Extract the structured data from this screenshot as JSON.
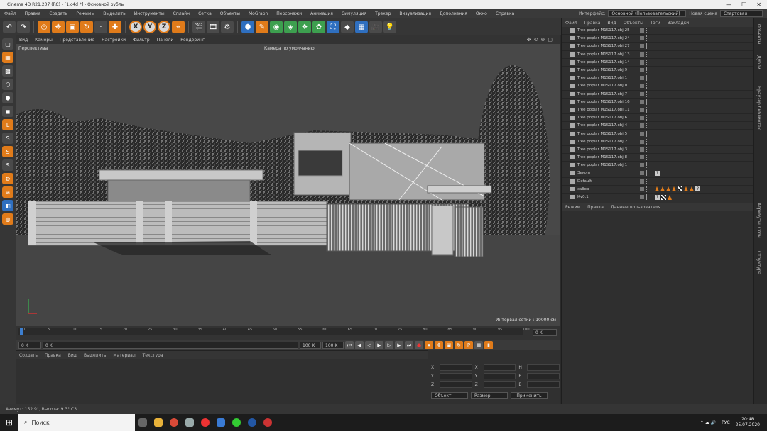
{
  "window": {
    "title": "Cinema 4D R21.207 (RC) - [1.c4d *] - Основной рубль"
  },
  "menu": [
    "Файл",
    "Правка",
    "Создать",
    "Режимы",
    "Выделить",
    "Инструменты",
    "Сплайн",
    "Сетка",
    "Объекты",
    "MoGraph",
    "Персонажи",
    "Анимация",
    "Симуляция",
    "Трекер",
    "Визуализация",
    "Дополнения",
    "Окно",
    "Справка"
  ],
  "menu_right": {
    "layout_label": "Интерфейс:",
    "layout_value": "Основной (Пользовательский)",
    "mode_label": "Новая сцена",
    "mode_value": "Стартовая"
  },
  "toolbar": {
    "axes": [
      "X",
      "Y",
      "Z"
    ]
  },
  "viewport": {
    "menu": [
      "Вид",
      "Камеры",
      "Представление",
      "Настройки",
      "Фильтр",
      "Панели",
      "Рендеринг"
    ],
    "view_label": "Перспектива",
    "camera_label": "Камера по умолчанию",
    "grid_label": "Интервал сетки : 10000 см"
  },
  "timeline": {
    "ticks": [
      "0",
      "5",
      "10",
      "15",
      "20",
      "25",
      "30",
      "35",
      "40",
      "45",
      "50",
      "55",
      "60",
      "65",
      "70",
      "75",
      "80",
      "85",
      "90",
      "95",
      "100"
    ],
    "end_frame": "0 K"
  },
  "transport": {
    "start": "0 K",
    "current": "0 K",
    "end_a": "100 K",
    "end_b": "100 K"
  },
  "material": {
    "menu": [
      "Создать",
      "Правка",
      "Вид",
      "Выделить",
      "Материал",
      "Текстура"
    ]
  },
  "coords": {
    "rows": [
      [
        "X",
        "X",
        "H"
      ],
      [
        "Y",
        "Y",
        "P"
      ],
      [
        "Z",
        "Z",
        "B"
      ]
    ],
    "col_a": "Объект",
    "col_b": "Размер",
    "apply": "Применить"
  },
  "objects": {
    "menu": [
      "Файл",
      "Правка",
      "Вид",
      "Объекты",
      "Тэги",
      "Закладки"
    ],
    "rows": [
      {
        "name": "Tree poplar M1S117.obj.25",
        "tags": []
      },
      {
        "name": "Tree poplar M1S117.obj.24",
        "tags": []
      },
      {
        "name": "Tree poplar M1S117.obj.27",
        "tags": []
      },
      {
        "name": "Tree poplar M1S117.obj.13",
        "tags": []
      },
      {
        "name": "Tree poplar M1S117.obj.14",
        "tags": []
      },
      {
        "name": "Tree poplar M1S117.obj.9",
        "tags": []
      },
      {
        "name": "Tree poplar M1S117.obj.1",
        "tags": []
      },
      {
        "name": "Tree poplar M1S117.obj.0",
        "tags": []
      },
      {
        "name": "Tree poplar M1S117.obj.7",
        "tags": []
      },
      {
        "name": "Tree poplar M1S117.obj.16",
        "tags": []
      },
      {
        "name": "Tree poplar M1S117.obj.11",
        "tags": []
      },
      {
        "name": "Tree poplar M1S117.obj.6",
        "tags": []
      },
      {
        "name": "Tree poplar M1S117.obj.4",
        "tags": []
      },
      {
        "name": "Tree poplar M1S117.obj.5",
        "tags": []
      },
      {
        "name": "Tree poplar M1S117.obj.2",
        "tags": []
      },
      {
        "name": "Tree poplar M1S117.obj.3",
        "tags": []
      },
      {
        "name": "Tree poplar M1S117.obj.8",
        "tags": []
      },
      {
        "name": "Tree poplar M1S117.obj.1",
        "tags": []
      },
      {
        "name": "Земля",
        "tags": [
          "q"
        ]
      },
      {
        "name": "Default",
        "tags": []
      },
      {
        "name": "забор",
        "tags": [
          "tri",
          "tri",
          "tri",
          "tri",
          "ck",
          "tri",
          "tri",
          "q"
        ]
      },
      {
        "name": "Куб.1",
        "tags": [
          "q",
          "ck",
          "tri"
        ]
      }
    ]
  },
  "attributes": {
    "menu": [
      "Режим",
      "Правка",
      "Данные пользователя"
    ]
  },
  "sidetabs": [
    "Объекты",
    "Дубли",
    "Браузер библиотек",
    "Атрибуты",
    "Слои",
    "Структура"
  ],
  "status": {
    "text": "Азимут: 152.9°, Высота: 9.3°  C3"
  },
  "taskbar": {
    "search_placeholder": "Поиск",
    "lang": "РУС",
    "time": "20:48",
    "date": "25.07.2020"
  }
}
